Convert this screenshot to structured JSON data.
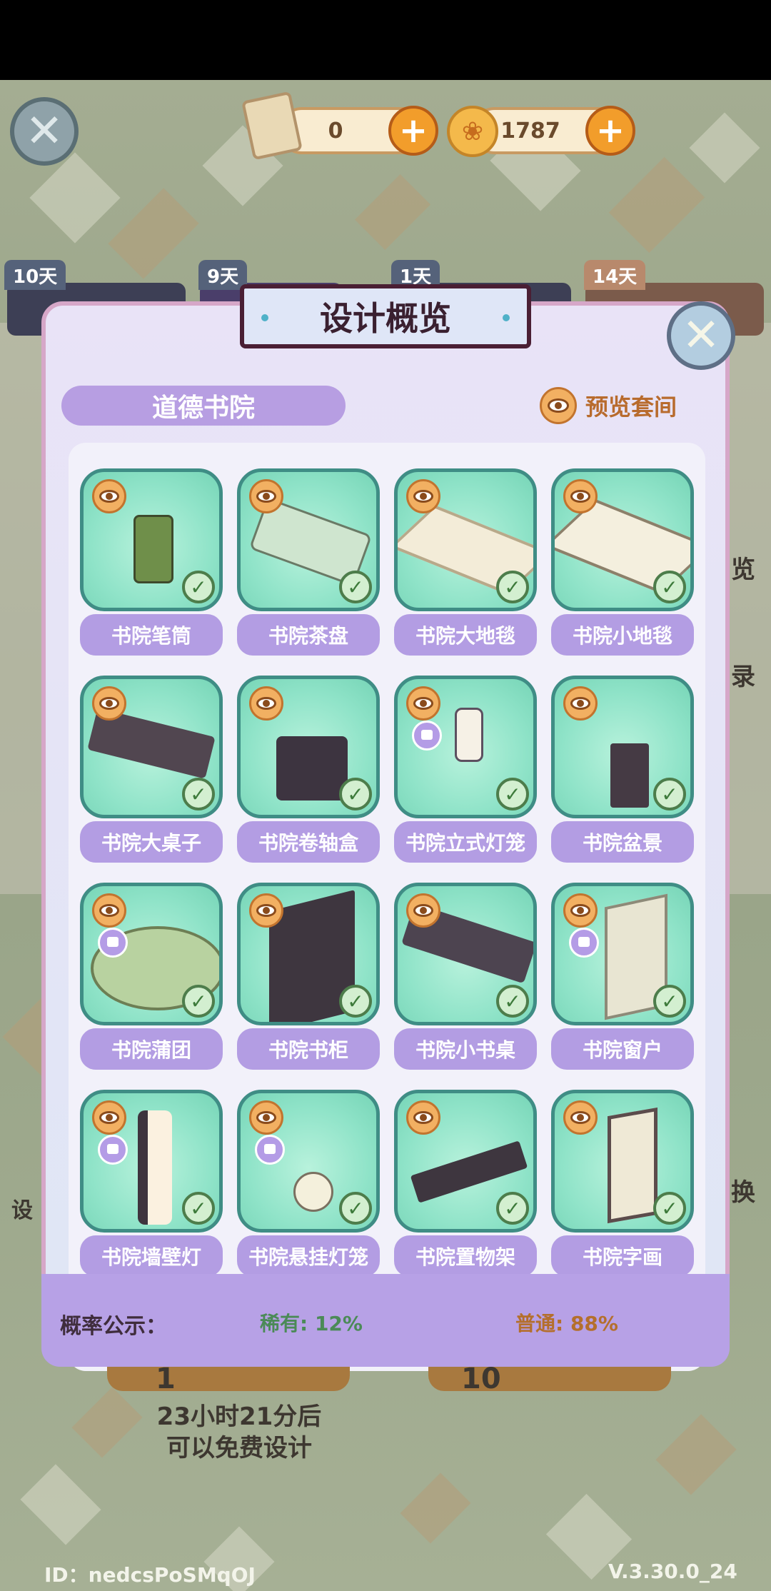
{
  "currency": {
    "scrolls": "0",
    "coins": "1787",
    "plus_symbol": "+"
  },
  "background_tabs": {
    "days": [
      "10天",
      "9天",
      "1天",
      "14天"
    ],
    "left_partial_label": "设",
    "right_partial_labels": [
      "览",
      "录",
      "换"
    ]
  },
  "modal": {
    "title": "设计概览",
    "set_name": "道德书院",
    "preview_label": "预览套间",
    "close_symbol": "✕",
    "items": [
      {
        "name": "书院笔筒",
        "tag": false
      },
      {
        "name": "书院茶盘",
        "tag": false
      },
      {
        "name": "书院大地毯",
        "tag": false
      },
      {
        "name": "书院小地毯",
        "tag": false
      },
      {
        "name": "书院大桌子",
        "tag": false
      },
      {
        "name": "书院卷轴盒",
        "tag": false
      },
      {
        "name": "书院立式灯笼",
        "tag": true
      },
      {
        "name": "书院盆景",
        "tag": false
      },
      {
        "name": "书院蒲团",
        "tag": true
      },
      {
        "name": "书院书柜",
        "tag": false
      },
      {
        "name": "书院小书桌",
        "tag": false
      },
      {
        "name": "书院窗户",
        "tag": true
      },
      {
        "name": "书院墙壁灯",
        "tag": true
      },
      {
        "name": "书院悬挂灯笼",
        "tag": true
      },
      {
        "name": "书院置物架",
        "tag": false
      },
      {
        "name": "书院字画",
        "tag": false
      }
    ],
    "check_symbol": "✓",
    "probability": {
      "label": "概率公示：",
      "rare": "稀有: 12%",
      "common": "普通: 88%"
    }
  },
  "bottom": {
    "button_left_num": "1",
    "button_right_num": "10",
    "timer_line1": "23小时21分后",
    "timer_line2": "可以免费设计"
  },
  "footer": {
    "id": "ID：nedcsPoSMqOJ",
    "version": "V.3.30.0_24"
  },
  "colors": {
    "accent_purple": "#b39de3",
    "tile_green": "#8fe3c8",
    "rare_green": "#4b8a57",
    "common_orange": "#b46f2c"
  }
}
